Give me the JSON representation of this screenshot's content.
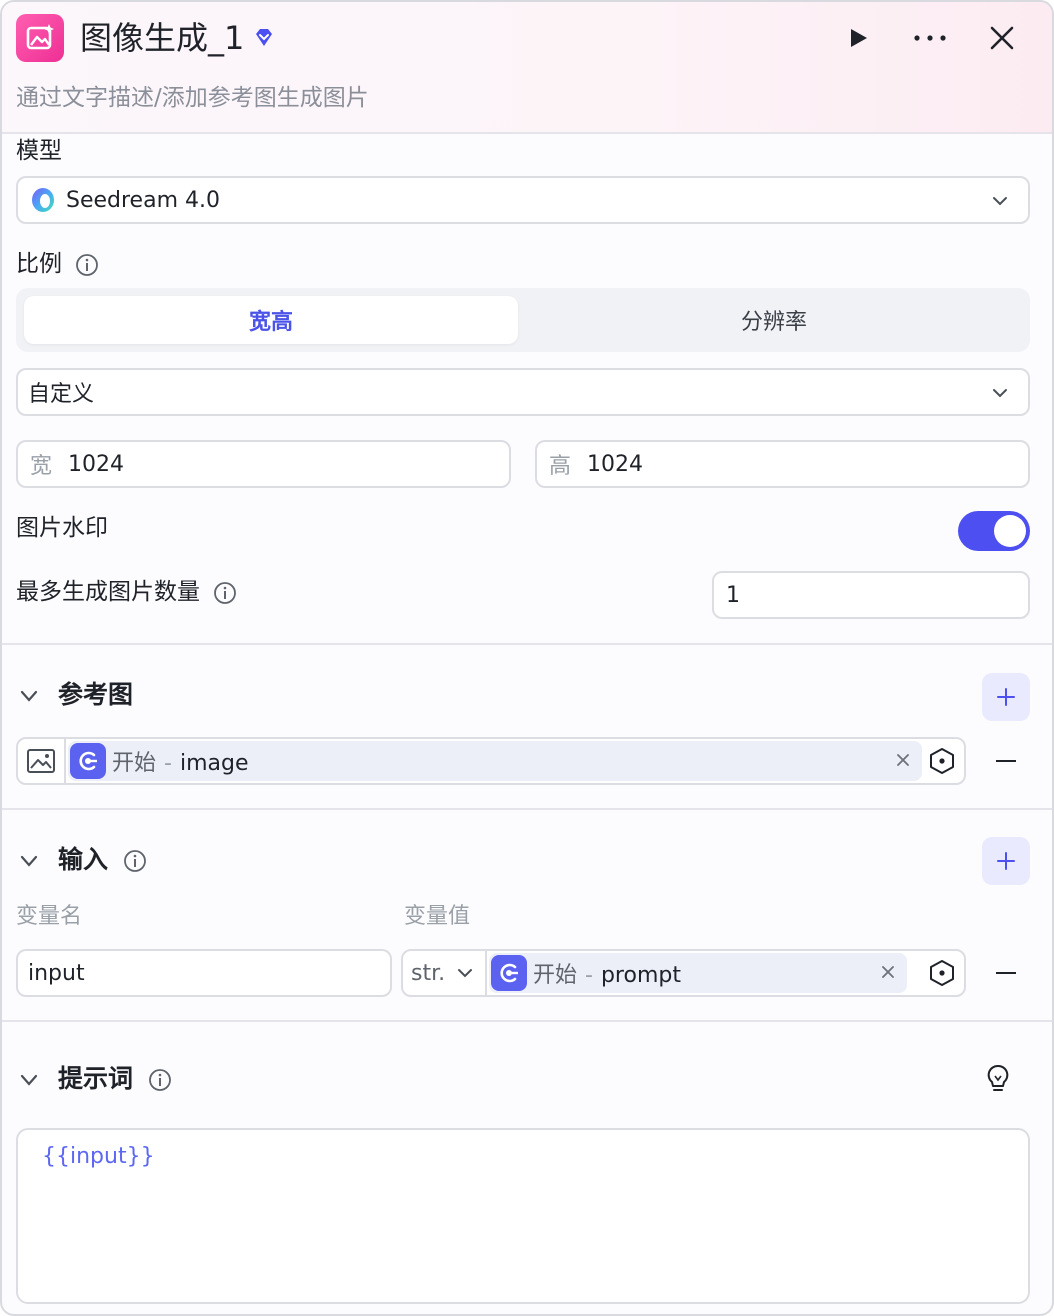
{
  "header": {
    "title": "图像生成_1",
    "subtitle": "通过文字描述/添加参考图生成图片",
    "icons": [
      "image-gen-icon",
      "gem-icon",
      "play-icon",
      "more-icon",
      "close-icon"
    ]
  },
  "model": {
    "label": "模型",
    "value": "Seedream 4.0"
  },
  "ratio": {
    "label": "比例",
    "tabs": [
      "宽高",
      "分辨率"
    ],
    "active_tab": "宽高",
    "preset": "自定义",
    "width_label": "宽",
    "width_value": "1024",
    "height_label": "高",
    "height_value": "1024"
  },
  "watermark": {
    "label": "图片水印",
    "enabled": true
  },
  "max_count": {
    "label": "最多生成图片数量",
    "value": "1"
  },
  "reference": {
    "title": "参考图",
    "chip_source": "开始",
    "chip_separator": "-",
    "chip_var": "image"
  },
  "inputs": {
    "title": "输入",
    "col_name": "变量名",
    "col_value": "变量值",
    "row_name": "input",
    "row_type": "str.",
    "chip_source": "开始",
    "chip_separator": "-",
    "chip_var": "prompt"
  },
  "prompt": {
    "title": "提示词",
    "value": "{{input}}"
  },
  "colors": {
    "accent": "#4d4ff0",
    "brand_pink": "#ee2f95"
  }
}
